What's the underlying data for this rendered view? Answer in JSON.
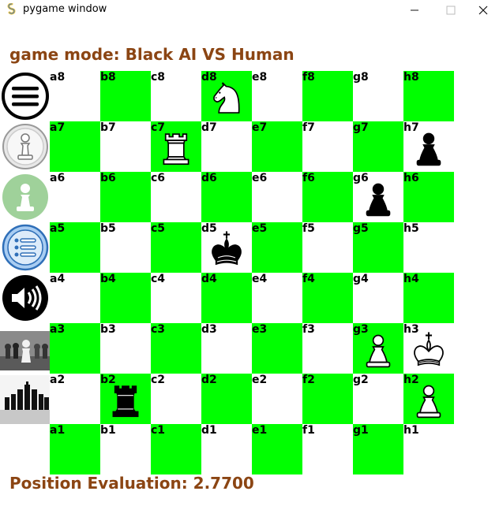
{
  "window": {
    "title": "pygame window",
    "app_icon": "pygame-snake-icon",
    "controls": [
      "minimize-icon",
      "maximize-icon",
      "close-icon"
    ]
  },
  "game": {
    "mode_text": "game mode: Black AI VS Human",
    "evaluation_text": "Position Evaluation: 2.7700"
  },
  "colors": {
    "light_square": "#ffffff",
    "dark_square": "#00ff00",
    "status_text": "#8b4513"
  },
  "sidebar": {
    "buttons": [
      {
        "name": "menu-button",
        "icon": "menu-icon"
      },
      {
        "name": "play-as-white-button",
        "icon": "white-pawn-icon"
      },
      {
        "name": "hint-button",
        "icon": "pawn-badge-icon"
      },
      {
        "name": "move-list-button",
        "icon": "list-icon"
      },
      {
        "name": "sound-button",
        "icon": "speaker-icon"
      },
      {
        "name": "white-pieces-theme-button",
        "icon": "white-pieces-photo-icon"
      },
      {
        "name": "black-pieces-theme-button",
        "icon": "black-pieces-photo-icon"
      }
    ]
  },
  "board": {
    "files": [
      "a",
      "b",
      "c",
      "d",
      "e",
      "f",
      "g",
      "h"
    ],
    "ranks": [
      "8",
      "7",
      "6",
      "5",
      "4",
      "3",
      "2",
      "1"
    ],
    "pieces": {
      "d8": "white-knight",
      "c7": "white-rook",
      "h7": "black-pawn",
      "g6": "black-pawn",
      "d5": "black-king",
      "g3": "white-pawn",
      "h3": "white-king",
      "b2": "black-rook",
      "h2": "white-pawn"
    }
  }
}
